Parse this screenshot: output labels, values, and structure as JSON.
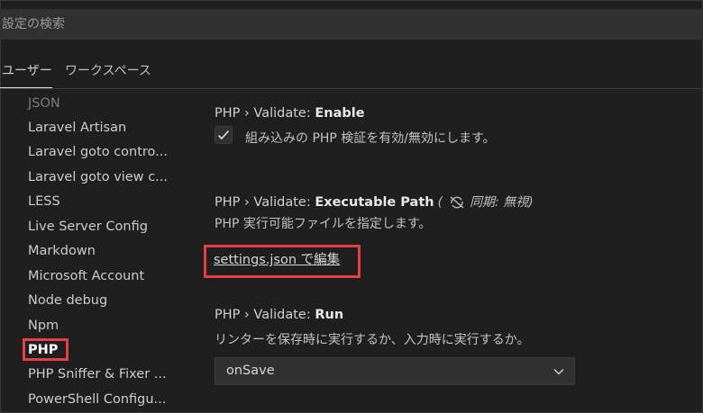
{
  "search": {
    "placeholder": "設定の検索"
  },
  "tabs": [
    {
      "label": "ユーザー",
      "active": true
    },
    {
      "label": "ワークスペース",
      "active": false
    }
  ],
  "toc": {
    "items": [
      {
        "label": "JSON"
      },
      {
        "label": "Laravel Artisan"
      },
      {
        "label": "Laravel goto contro..."
      },
      {
        "label": "Laravel goto view c..."
      },
      {
        "label": "LESS"
      },
      {
        "label": "Live Server Config"
      },
      {
        "label": "Markdown"
      },
      {
        "label": "Microsoft Account"
      },
      {
        "label": "Node debug"
      },
      {
        "label": "Npm"
      },
      {
        "label": "PHP",
        "active": true
      },
      {
        "label": "PHP Sniffer & Fixer ..."
      },
      {
        "label": "PowerShell Configu..."
      }
    ]
  },
  "settings": {
    "enable": {
      "prefix": "PHP › Validate: ",
      "name": "Enable",
      "description": "組み込みの PHP 検証を有効/無効にします。",
      "checked": true
    },
    "executable_path": {
      "prefix": "PHP › Validate: ",
      "name": "Executable Path",
      "sync_note": "(",
      "sync_text": "同期: 無視)",
      "description": "PHP 実行可能ファイルを指定します。",
      "link": "settings.json で編集"
    },
    "run": {
      "prefix": "PHP › Validate: ",
      "name": "Run",
      "description": "リンターを保存時に実行するか、入力時に実行するか。",
      "value": "onSave"
    }
  },
  "colors": {
    "background": "#1f1f1f",
    "highlight": "#e63f46"
  }
}
